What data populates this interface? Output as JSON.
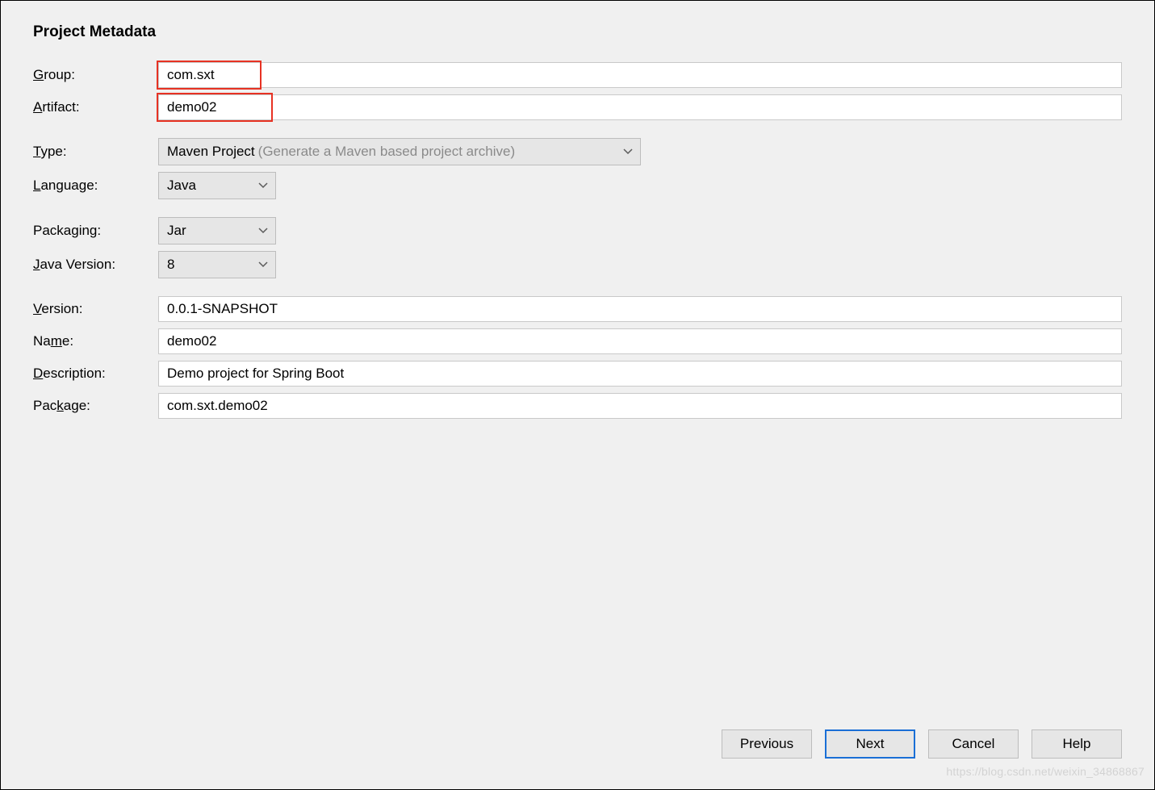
{
  "heading": "Project Metadata",
  "labels": {
    "group": "Group:",
    "artifact": "Artifact:",
    "type": "Type:",
    "language": "Language:",
    "packaging": "Packaging:",
    "javaVersion": "Java Version:",
    "version": "Version:",
    "name": "Name:",
    "description": "Description:",
    "package": "Package:"
  },
  "fields": {
    "group": "com.sxt",
    "artifact": "demo02",
    "type": "Maven Project",
    "typeHint": "(Generate a Maven based project archive)",
    "language": "Java",
    "packaging": "Jar",
    "javaVersion": "8",
    "version": "0.0.1-SNAPSHOT",
    "name": "demo02",
    "description": "Demo project for Spring Boot",
    "package": "com.sxt.demo02"
  },
  "buttons": {
    "previous": "Previous",
    "next": "Next",
    "cancel": "Cancel",
    "help": "Help"
  },
  "watermark": "https://blog.csdn.net/weixin_34868867"
}
